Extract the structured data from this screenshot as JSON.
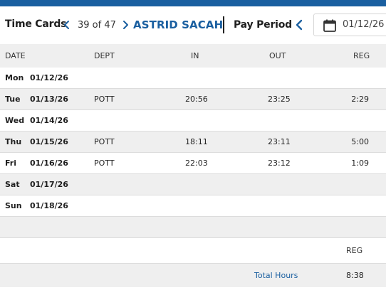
{
  "header": {
    "title": "Time Cards",
    "record_position": "39 of 47",
    "employee_name": "ASTRID SACAH",
    "pay_period_label": "Pay Period",
    "pay_period_date": "01/12/26"
  },
  "colors": {
    "accent": "#1a5fa0",
    "row_alt": "#efefef"
  },
  "table": {
    "headers": {
      "date": "DATE",
      "dept": "DEPT",
      "in": "IN",
      "out": "OUT",
      "reg": "REG"
    },
    "rows": [
      {
        "day": "Mon",
        "date": "01/12/26",
        "dept": "",
        "in": "",
        "out": "",
        "reg": ""
      },
      {
        "day": "Tue",
        "date": "01/13/26",
        "dept": "POTT",
        "in": "20:56",
        "out": "23:25",
        "reg": "2:29"
      },
      {
        "day": "Wed",
        "date": "01/14/26",
        "dept": "",
        "in": "",
        "out": "",
        "reg": ""
      },
      {
        "day": "Thu",
        "date": "01/15/26",
        "dept": "POTT",
        "in": "18:11",
        "out": "23:11",
        "reg": "5:00"
      },
      {
        "day": "Fri",
        "date": "01/16/26",
        "dept": "POTT",
        "in": "22:03",
        "out": "23:12",
        "reg": "1:09"
      },
      {
        "day": "Sat",
        "date": "01/17/26",
        "dept": "",
        "in": "",
        "out": "",
        "reg": ""
      },
      {
        "day": "Sun",
        "date": "01/18/26",
        "dept": "",
        "in": "",
        "out": "",
        "reg": ""
      }
    ]
  },
  "summary": {
    "reg_header": "REG",
    "total_label": "Total Hours",
    "total_reg": "8:38"
  },
  "icons": {
    "prev": "chevron-left-icon",
    "next": "chevron-right-icon",
    "calendar": "calendar-icon"
  }
}
